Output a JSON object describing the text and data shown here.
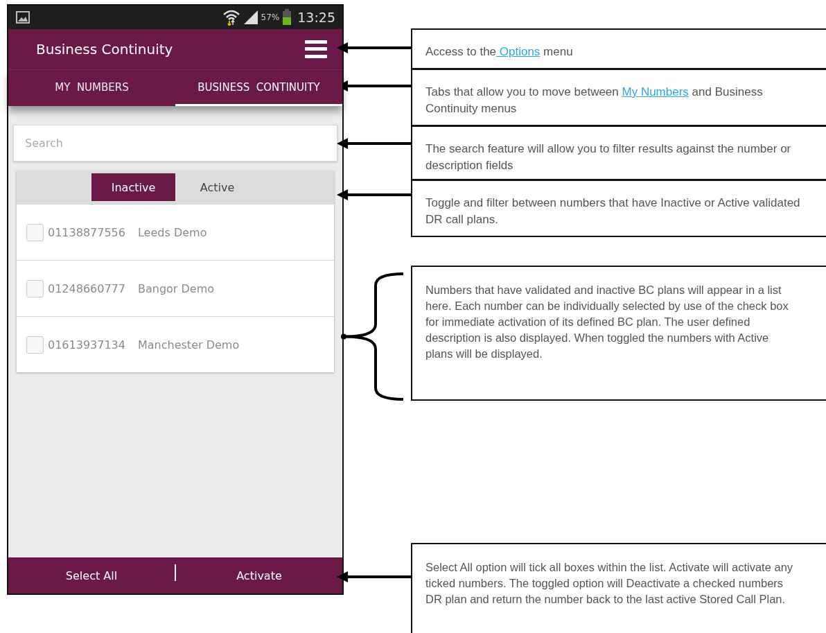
{
  "phone": {
    "status_bar": {
      "battery": "57%",
      "time": "13:25"
    },
    "app_bar": {
      "title": "Business Continuity"
    },
    "tabs": [
      {
        "label": "MY  NUMBERS",
        "selected": false
      },
      {
        "label": "BUSINESS  CONTINUITY",
        "selected": true
      }
    ],
    "search": {
      "placeholder": "Search"
    },
    "toggle": [
      {
        "label": "Inactive",
        "selected": true
      },
      {
        "label": "Active",
        "selected": false
      }
    ],
    "numbers": [
      {
        "number": "01138877556",
        "description": "Leeds Demo",
        "checked": false
      },
      {
        "number": "01248660777",
        "description": "Bangor Demo",
        "checked": false
      },
      {
        "number": "01613937134",
        "description": "Manchester Demo",
        "checked": false
      }
    ],
    "bottom_bar": [
      "Select All",
      "Activate"
    ]
  },
  "callouts": [
    {
      "kind": "arrow",
      "parts": [
        {
          "kind": "text",
          "text": "Access to the"
        },
        {
          "kind": "link",
          "text": " Options"
        },
        {
          "kind": "text",
          "text": " menu"
        }
      ]
    },
    {
      "kind": "arrow",
      "parts": [
        {
          "kind": "text",
          "text": "Tabs that allow you to move between "
        },
        {
          "kind": "link",
          "text": "My Numbers"
        },
        {
          "kind": "text",
          "text": " and Business Continuity menus"
        }
      ]
    },
    {
      "kind": "arrow",
      "parts": [
        {
          "kind": "text",
          "text": "The search feature will allow you to filter results against the number or description fields"
        }
      ]
    },
    {
      "kind": "arrow",
      "parts": [
        {
          "kind": "text",
          "text": "Toggle and filter between numbers that have Inactive or Active validated DR call plans."
        }
      ]
    },
    {
      "kind": "brace",
      "parts": [
        {
          "kind": "text",
          "text": "Numbers that have validated and inactive BC plans will appear in a list here. Each number can be individually selected by use of the check box for immediate activation of its defined BC plan. The user defined description is also displayed. When toggled the numbers with Active plans will be displayed."
        }
      ]
    },
    {
      "kind": "arrow",
      "parts": [
        {
          "kind": "text",
          "text": "Select All option will tick all boxes within the list. Activate will activate any ticked numbers. The toggled option will Deactivate a checked numbers DR plan and return the number back to the last active Stored Call Plan."
        }
      ]
    }
  ]
}
